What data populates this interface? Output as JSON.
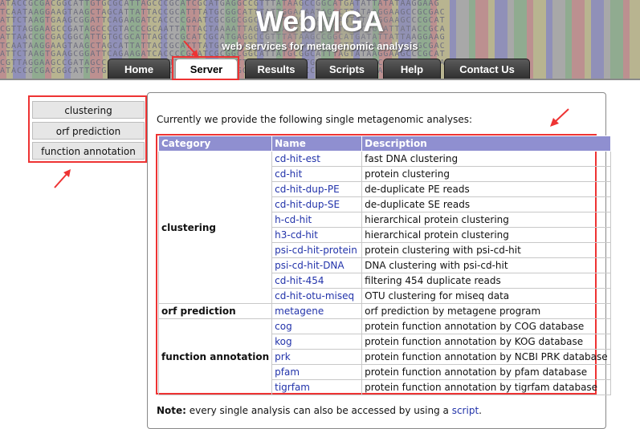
{
  "banner": {
    "title": "WebMGA",
    "subtitle": "web services for metagenomic analysis",
    "dna_lines": [
      "ATACCGCGACGGCATTGTGCGCATTAGCCCGCATCGCATGAGGCCGTTTATAAGCCGGCATGATATTATATAAGGAAG",
      "TCAATAAGGAAGTAAGCTAGCATTATTACCGCATTTATGCGGCATTTATTGGAAAATAGGCTTATAAGGAAGCCGCGAC",
      "ATTCTAAGTGAAGCGGATTCAGAAGATCACCCCGAATCGCGGCGGCATTATGCGGCATTTAGTATAAGGAAGCCCGCAT",
      "CGTTAGGAAGCCGATAGCCCGTACCCGCAATTATTACTAAAATTAGCCGCATATTGTCCCTATGCCGCATTATACCGCA",
      "ATTAACCGCGACGGCATTGTGCGCATTAGCCCGCATCGCATGAGGCCGTTTATAAGCCGGCATGATATTATTAAGGAAG",
      "TCAATAAGGAAGTAAGCTAGCATTATTACCGCATTTATGCGGCATTTATTGGAAAATAGGCTTATAAGGAAGCCGCGAC",
      "ATTCTAAGTGAAGCGGATTCAGAAGATCACCCCGAATCGCGGCGGCATTATGCGGCATTTAGTATAAGGAAGCCCGCAT",
      "CGTTAGGAAGCCGATAGCCCGTACCCGCAATTATTACTAAAATTAGCCGCATATTGTCCCTATGCCGCATTATACCGCA",
      "ATACCGCGACGGCATTGTGCGCATTAGCCCGCATCGCATGAGGCCGTTTATAAGCCGGCATGATATTATATAAGGAAG"
    ]
  },
  "nav": {
    "tabs": [
      {
        "label": "Home"
      },
      {
        "label": "Server"
      },
      {
        "label": "Results"
      },
      {
        "label": "Scripts"
      },
      {
        "label": "Help"
      },
      {
        "label": "Contact Us"
      }
    ],
    "active": "Server"
  },
  "sidebar": {
    "items": [
      {
        "label": "clustering"
      },
      {
        "label": "orf prediction"
      },
      {
        "label": "function annotation"
      }
    ]
  },
  "main": {
    "intro": "Currently we provide the following single metagenomic analyses:",
    "table": {
      "headers": [
        "Category",
        "Name",
        "Description"
      ],
      "groups": [
        {
          "category": "clustering",
          "rows": [
            {
              "name": "cd-hit-est",
              "description": "fast DNA clustering"
            },
            {
              "name": "cd-hit",
              "description": "protein clustering"
            },
            {
              "name": "cd-hit-dup-PE",
              "description": "de-duplicate PE reads"
            },
            {
              "name": "cd-hit-dup-SE",
              "description": "de-duplicate SE reads"
            },
            {
              "name": "h-cd-hit",
              "description": "hierarchical protein clustering"
            },
            {
              "name": "h3-cd-hit",
              "description": "hierarchical protein clustering"
            },
            {
              "name": "psi-cd-hit-protein",
              "description": "protein clustering with psi-cd-hit"
            },
            {
              "name": "psi-cd-hit-DNA",
              "description": "DNA clustering with psi-cd-hit"
            },
            {
              "name": "cd-hit-454",
              "description": "filtering 454 duplicate reads"
            },
            {
              "name": "cd-hit-otu-miseq",
              "description": "OTU clustering for miseq data"
            }
          ]
        },
        {
          "category": "orf prediction",
          "rows": [
            {
              "name": "metagene",
              "description": "orf prediction by metagene program"
            }
          ]
        },
        {
          "category": "function annotation",
          "rows": [
            {
              "name": "cog",
              "description": "protein function annotation by COG database"
            },
            {
              "name": "kog",
              "description": "protein function annotation by KOG database"
            },
            {
              "name": "prk",
              "description": "protein function annotation by NCBI PRK database"
            },
            {
              "name": "pfam",
              "description": "protein function annotation by pfam database"
            },
            {
              "name": "tigrfam",
              "description": "protein function annotation by tigrfam database"
            }
          ]
        }
      ]
    },
    "note": {
      "bold": "Note:",
      "text": " every single analysis can also be accessed by using a ",
      "link": "script",
      "end": "."
    }
  },
  "colors": {
    "header_bg": "#8f8fd0",
    "link": "#2233aa",
    "annotation_red": "#e33333",
    "nav_tab": "#3a3a3a"
  }
}
